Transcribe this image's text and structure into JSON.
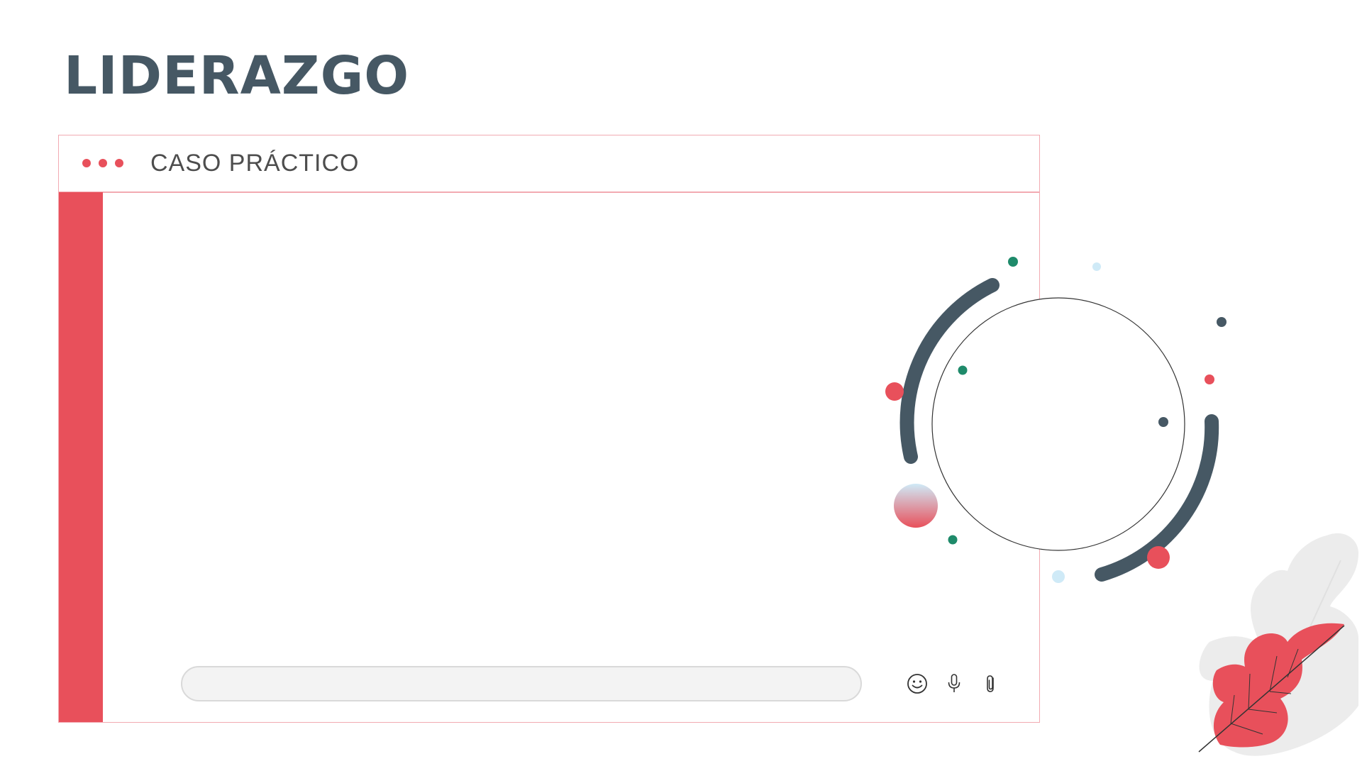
{
  "page": {
    "title": "LIDERAZGO"
  },
  "window": {
    "header_title": "CASO PRÁCTICO",
    "controls": [
      "dot",
      "dot",
      "dot"
    ]
  },
  "composer": {
    "message_value": "",
    "message_placeholder": "",
    "actions": [
      {
        "icon": "emoji-icon"
      },
      {
        "icon": "microphone-icon"
      },
      {
        "icon": "paperclip-icon"
      }
    ]
  },
  "colors": {
    "accent": "#e8505b",
    "title": "#465864",
    "arc": "#465864",
    "teal_dot": "#1e8a6a",
    "light_blue": "#cfeaf7",
    "leaf_gray": "#ececec"
  }
}
